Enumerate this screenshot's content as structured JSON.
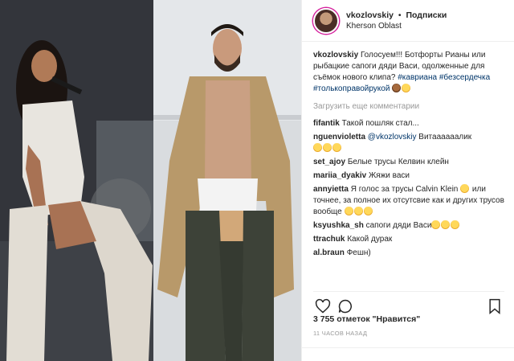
{
  "header": {
    "username": "vkozlovskiy",
    "separator": "•",
    "follow_label": "Подписки",
    "location": "Kherson Oblast"
  },
  "caption": {
    "username": "vkozlovskiy",
    "text": "Голосуем!!! Ботфорты Рианы или рыбацкие сапоги дяди Васи, одолженные для съёмок нового клипа?",
    "tags": [
      "#кавриана",
      "#безсердечка",
      "#толькоправойрукой"
    ]
  },
  "load_more_label": "Загрузить еще комментарии",
  "comments": [
    {
      "user": "fifantik",
      "text": "Такой пошляк стал..."
    },
    {
      "user": "nguenvioletta",
      "mention": "@vkozlovskiy",
      "text": "Витаааааалик"
    },
    {
      "user": "set_ajoy",
      "text": "Белые трусы Келвин клейн"
    },
    {
      "user": "mariia_dyakiv",
      "text": "Жяжи васи"
    },
    {
      "user": "annyietta",
      "text": "Я голос за трусы Calvin Klein",
      "text2": "или точнее, за полное их отсутсвие как и других трусов вообще"
    },
    {
      "user": "ksyushka_sh",
      "text": "сапоги дяди Васи"
    },
    {
      "user": "ttrachuk",
      "text": "Какой дурак"
    },
    {
      "user": "al.braun",
      "text": "Фешн)"
    }
  ],
  "likes": "3 755 отметок \"Нравится\"",
  "timestamp": "11 ЧАСОВ НАЗАД",
  "icons": {
    "like": "heart-icon",
    "comment": "comment-icon",
    "save": "bookmark-icon"
  },
  "colors": {
    "text": "#262626",
    "muted": "#999999",
    "link": "#003569",
    "border": "#efefef"
  }
}
